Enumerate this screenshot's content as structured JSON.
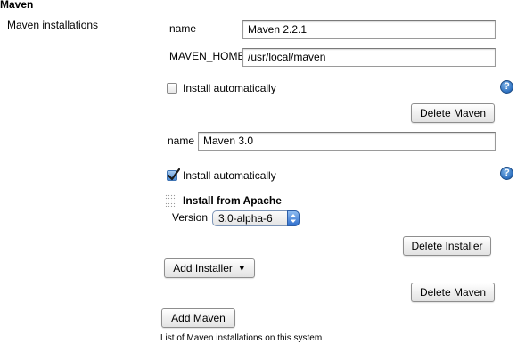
{
  "section": {
    "title": "Maven"
  },
  "installations": {
    "label": "Maven installations",
    "first": {
      "name_label": "name",
      "name_value": "Maven 2.2.1",
      "home_label": "MAVEN_HOME",
      "home_value": "/usr/local/maven",
      "install_auto_label": "Install automatically",
      "install_auto_checked": false,
      "delete_label": "Delete Maven"
    },
    "second": {
      "name_label": "name",
      "name_value": "Maven 3.0",
      "install_auto_label": "Install automatically",
      "install_auto_checked": true,
      "installer": {
        "title": "Install from Apache",
        "version_label": "Version",
        "version_value": "3.0-alpha-6",
        "delete_installer_label": "Delete Installer"
      },
      "add_installer_label": "Add Installer",
      "delete_label": "Delete Maven"
    },
    "add_button_label": "Add Maven",
    "description": "List of Maven installations on this system"
  },
  "help_icon_text": "?",
  "colors": {
    "accent": "#2c6fbf",
    "checkbox_checked": "#4a8bd6"
  }
}
